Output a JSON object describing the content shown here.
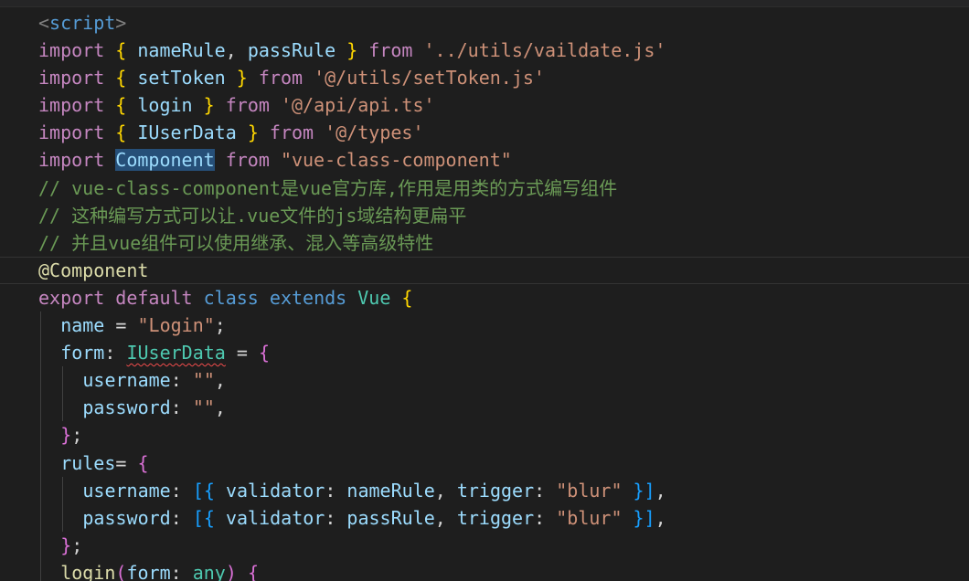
{
  "editor": {
    "lines": [
      {
        "tokens": [
          [
            "tag",
            "<"
          ],
          [
            "tagname",
            "script"
          ],
          [
            "tag",
            ">"
          ]
        ]
      },
      {
        "tokens": [
          [
            "kw",
            "import"
          ],
          [
            "punc",
            " "
          ],
          [
            "brace",
            "{"
          ],
          [
            "punc",
            " "
          ],
          [
            "var",
            "nameRule"
          ],
          [
            "punc",
            ", "
          ],
          [
            "var",
            "passRule"
          ],
          [
            "punc",
            " "
          ],
          [
            "brace",
            "}"
          ],
          [
            "punc",
            " "
          ],
          [
            "kw",
            "from"
          ],
          [
            "punc",
            " "
          ],
          [
            "str",
            "'../utils/vaildate.js'"
          ]
        ]
      },
      {
        "tokens": [
          [
            "kw",
            "import"
          ],
          [
            "punc",
            " "
          ],
          [
            "brace",
            "{"
          ],
          [
            "punc",
            " "
          ],
          [
            "var",
            "setToken"
          ],
          [
            "punc",
            " "
          ],
          [
            "brace",
            "}"
          ],
          [
            "punc",
            " "
          ],
          [
            "kw",
            "from"
          ],
          [
            "punc",
            " "
          ],
          [
            "str",
            "'@/utils/setToken.js'"
          ]
        ]
      },
      {
        "tokens": [
          [
            "kw",
            "import"
          ],
          [
            "punc",
            " "
          ],
          [
            "brace",
            "{"
          ],
          [
            "punc",
            " "
          ],
          [
            "var",
            "login"
          ],
          [
            "punc",
            " "
          ],
          [
            "brace",
            "}"
          ],
          [
            "punc",
            " "
          ],
          [
            "kw",
            "from"
          ],
          [
            "punc",
            " "
          ],
          [
            "str",
            "'@/api/api.ts'"
          ]
        ]
      },
      {
        "tokens": [
          [
            "kw",
            "import"
          ],
          [
            "punc",
            " "
          ],
          [
            "brace",
            "{"
          ],
          [
            "punc",
            " "
          ],
          [
            "var",
            "IUserData"
          ],
          [
            "punc",
            " "
          ],
          [
            "brace",
            "}"
          ],
          [
            "punc",
            " "
          ],
          [
            "kw",
            "from"
          ],
          [
            "punc",
            " "
          ],
          [
            "str",
            "'@/types'"
          ]
        ]
      },
      {
        "tokens": [
          [
            "kw",
            "import"
          ],
          [
            "punc",
            " "
          ],
          [
            "var hl-sel",
            "Component"
          ],
          [
            "punc",
            " "
          ],
          [
            "kw",
            "from"
          ],
          [
            "punc",
            " "
          ],
          [
            "str",
            "\"vue-class-component\""
          ]
        ]
      },
      {
        "tokens": [
          [
            "cmt",
            "// vue-class-component是vue官方库,作用是用类的方式编写组件"
          ]
        ]
      },
      {
        "tokens": [
          [
            "cmt",
            "// 这种编写方式可以让.vue文件的js域结构更扁平"
          ]
        ]
      },
      {
        "tokens": [
          [
            "cmt",
            "// 并且vue组件可以使用继承、混入等高级特性"
          ]
        ]
      },
      {
        "tokens": [
          [
            "dec",
            "@Component"
          ]
        ],
        "current": true
      },
      {
        "tokens": [
          [
            "kw",
            "export"
          ],
          [
            "punc",
            " "
          ],
          [
            "kw",
            "default"
          ],
          [
            "punc",
            " "
          ],
          [
            "storage",
            "class"
          ],
          [
            "punc",
            " "
          ],
          [
            "storage",
            "extends"
          ],
          [
            "punc",
            " "
          ],
          [
            "type",
            "Vue"
          ],
          [
            "punc",
            " "
          ],
          [
            "brace",
            "{"
          ]
        ]
      },
      {
        "indent": 1,
        "tokens": [
          [
            "var",
            "name"
          ],
          [
            "punc",
            " = "
          ],
          [
            "str",
            "\"Login\""
          ],
          [
            "punc",
            ";"
          ]
        ]
      },
      {
        "indent": 1,
        "tokens": [
          [
            "var",
            "form"
          ],
          [
            "punc",
            ": "
          ],
          [
            "type squiggle",
            "IUserData"
          ],
          [
            "punc",
            " = "
          ],
          [
            "brace2",
            "{"
          ]
        ]
      },
      {
        "indent": 2,
        "tokens": [
          [
            "var",
            "username"
          ],
          [
            "punc",
            ": "
          ],
          [
            "str",
            "\"\""
          ],
          [
            "punc",
            ","
          ]
        ]
      },
      {
        "indent": 2,
        "tokens": [
          [
            "var",
            "password"
          ],
          [
            "punc",
            ": "
          ],
          [
            "str",
            "\"\""
          ],
          [
            "punc",
            ","
          ]
        ]
      },
      {
        "indent": 1,
        "tokens": [
          [
            "brace2",
            "}"
          ],
          [
            "punc",
            ";"
          ]
        ]
      },
      {
        "indent": 1,
        "tokens": [
          [
            "var",
            "rules"
          ],
          [
            "punc",
            "= "
          ],
          [
            "brace2",
            "{"
          ]
        ]
      },
      {
        "indent": 2,
        "tokens": [
          [
            "var",
            "username"
          ],
          [
            "punc",
            ": "
          ],
          [
            "brace3",
            "[{"
          ],
          [
            "punc",
            " "
          ],
          [
            "var",
            "validator"
          ],
          [
            "punc",
            ": "
          ],
          [
            "var",
            "nameRule"
          ],
          [
            "punc",
            ", "
          ],
          [
            "var",
            "trigger"
          ],
          [
            "punc",
            ": "
          ],
          [
            "str",
            "\"blur\""
          ],
          [
            "punc",
            " "
          ],
          [
            "brace3",
            "}]"
          ],
          [
            "punc",
            ","
          ]
        ]
      },
      {
        "indent": 2,
        "tokens": [
          [
            "var",
            "password"
          ],
          [
            "punc",
            ": "
          ],
          [
            "brace3",
            "[{"
          ],
          [
            "punc",
            " "
          ],
          [
            "var",
            "validator"
          ],
          [
            "punc",
            ": "
          ],
          [
            "var",
            "passRule"
          ],
          [
            "punc",
            ", "
          ],
          [
            "var",
            "trigger"
          ],
          [
            "punc",
            ": "
          ],
          [
            "str",
            "\"blur\""
          ],
          [
            "punc",
            " "
          ],
          [
            "brace3",
            "}]"
          ],
          [
            "punc",
            ","
          ]
        ]
      },
      {
        "indent": 1,
        "tokens": [
          [
            "brace2",
            "}"
          ],
          [
            "punc",
            ";"
          ]
        ]
      },
      {
        "indent": 1,
        "tokens": [
          [
            "fn",
            "login"
          ],
          [
            "brace2",
            "("
          ],
          [
            "var",
            "form"
          ],
          [
            "punc",
            ": "
          ],
          [
            "type",
            "any"
          ],
          [
            "brace2",
            ")"
          ],
          [
            "punc",
            " "
          ],
          [
            "brace2",
            "{"
          ]
        ]
      }
    ]
  }
}
